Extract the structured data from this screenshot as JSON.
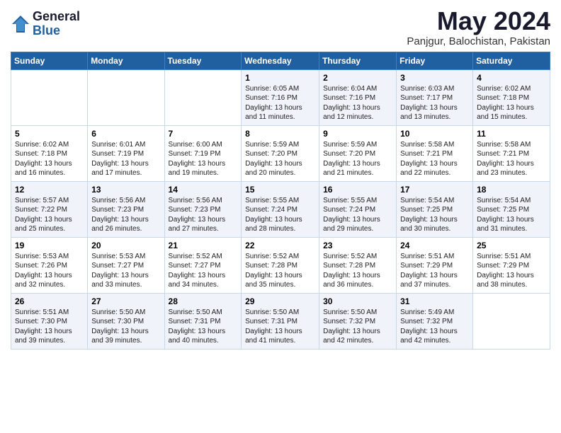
{
  "header": {
    "logo_general": "General",
    "logo_blue": "Blue",
    "month_title": "May 2024",
    "location": "Panjgur, Balochistan, Pakistan"
  },
  "days_of_week": [
    "Sunday",
    "Monday",
    "Tuesday",
    "Wednesday",
    "Thursday",
    "Friday",
    "Saturday"
  ],
  "weeks": [
    [
      {
        "day": "",
        "text": ""
      },
      {
        "day": "",
        "text": ""
      },
      {
        "day": "",
        "text": ""
      },
      {
        "day": "1",
        "text": "Sunrise: 6:05 AM\nSunset: 7:16 PM\nDaylight: 13 hours and 11 minutes."
      },
      {
        "day": "2",
        "text": "Sunrise: 6:04 AM\nSunset: 7:16 PM\nDaylight: 13 hours and 12 minutes."
      },
      {
        "day": "3",
        "text": "Sunrise: 6:03 AM\nSunset: 7:17 PM\nDaylight: 13 hours and 13 minutes."
      },
      {
        "day": "4",
        "text": "Sunrise: 6:02 AM\nSunset: 7:18 PM\nDaylight: 13 hours and 15 minutes."
      }
    ],
    [
      {
        "day": "5",
        "text": "Sunrise: 6:02 AM\nSunset: 7:18 PM\nDaylight: 13 hours and 16 minutes."
      },
      {
        "day": "6",
        "text": "Sunrise: 6:01 AM\nSunset: 7:19 PM\nDaylight: 13 hours and 17 minutes."
      },
      {
        "day": "7",
        "text": "Sunrise: 6:00 AM\nSunset: 7:19 PM\nDaylight: 13 hours and 19 minutes."
      },
      {
        "day": "8",
        "text": "Sunrise: 5:59 AM\nSunset: 7:20 PM\nDaylight: 13 hours and 20 minutes."
      },
      {
        "day": "9",
        "text": "Sunrise: 5:59 AM\nSunset: 7:20 PM\nDaylight: 13 hours and 21 minutes."
      },
      {
        "day": "10",
        "text": "Sunrise: 5:58 AM\nSunset: 7:21 PM\nDaylight: 13 hours and 22 minutes."
      },
      {
        "day": "11",
        "text": "Sunrise: 5:58 AM\nSunset: 7:21 PM\nDaylight: 13 hours and 23 minutes."
      }
    ],
    [
      {
        "day": "12",
        "text": "Sunrise: 5:57 AM\nSunset: 7:22 PM\nDaylight: 13 hours and 25 minutes."
      },
      {
        "day": "13",
        "text": "Sunrise: 5:56 AM\nSunset: 7:23 PM\nDaylight: 13 hours and 26 minutes."
      },
      {
        "day": "14",
        "text": "Sunrise: 5:56 AM\nSunset: 7:23 PM\nDaylight: 13 hours and 27 minutes."
      },
      {
        "day": "15",
        "text": "Sunrise: 5:55 AM\nSunset: 7:24 PM\nDaylight: 13 hours and 28 minutes."
      },
      {
        "day": "16",
        "text": "Sunrise: 5:55 AM\nSunset: 7:24 PM\nDaylight: 13 hours and 29 minutes."
      },
      {
        "day": "17",
        "text": "Sunrise: 5:54 AM\nSunset: 7:25 PM\nDaylight: 13 hours and 30 minutes."
      },
      {
        "day": "18",
        "text": "Sunrise: 5:54 AM\nSunset: 7:25 PM\nDaylight: 13 hours and 31 minutes."
      }
    ],
    [
      {
        "day": "19",
        "text": "Sunrise: 5:53 AM\nSunset: 7:26 PM\nDaylight: 13 hours and 32 minutes."
      },
      {
        "day": "20",
        "text": "Sunrise: 5:53 AM\nSunset: 7:27 PM\nDaylight: 13 hours and 33 minutes."
      },
      {
        "day": "21",
        "text": "Sunrise: 5:52 AM\nSunset: 7:27 PM\nDaylight: 13 hours and 34 minutes."
      },
      {
        "day": "22",
        "text": "Sunrise: 5:52 AM\nSunset: 7:28 PM\nDaylight: 13 hours and 35 minutes."
      },
      {
        "day": "23",
        "text": "Sunrise: 5:52 AM\nSunset: 7:28 PM\nDaylight: 13 hours and 36 minutes."
      },
      {
        "day": "24",
        "text": "Sunrise: 5:51 AM\nSunset: 7:29 PM\nDaylight: 13 hours and 37 minutes."
      },
      {
        "day": "25",
        "text": "Sunrise: 5:51 AM\nSunset: 7:29 PM\nDaylight: 13 hours and 38 minutes."
      }
    ],
    [
      {
        "day": "26",
        "text": "Sunrise: 5:51 AM\nSunset: 7:30 PM\nDaylight: 13 hours and 39 minutes."
      },
      {
        "day": "27",
        "text": "Sunrise: 5:50 AM\nSunset: 7:30 PM\nDaylight: 13 hours and 39 minutes."
      },
      {
        "day": "28",
        "text": "Sunrise: 5:50 AM\nSunset: 7:31 PM\nDaylight: 13 hours and 40 minutes."
      },
      {
        "day": "29",
        "text": "Sunrise: 5:50 AM\nSunset: 7:31 PM\nDaylight: 13 hours and 41 minutes."
      },
      {
        "day": "30",
        "text": "Sunrise: 5:50 AM\nSunset: 7:32 PM\nDaylight: 13 hours and 42 minutes."
      },
      {
        "day": "31",
        "text": "Sunrise: 5:49 AM\nSunset: 7:32 PM\nDaylight: 13 hours and 42 minutes."
      },
      {
        "day": "",
        "text": ""
      }
    ]
  ]
}
